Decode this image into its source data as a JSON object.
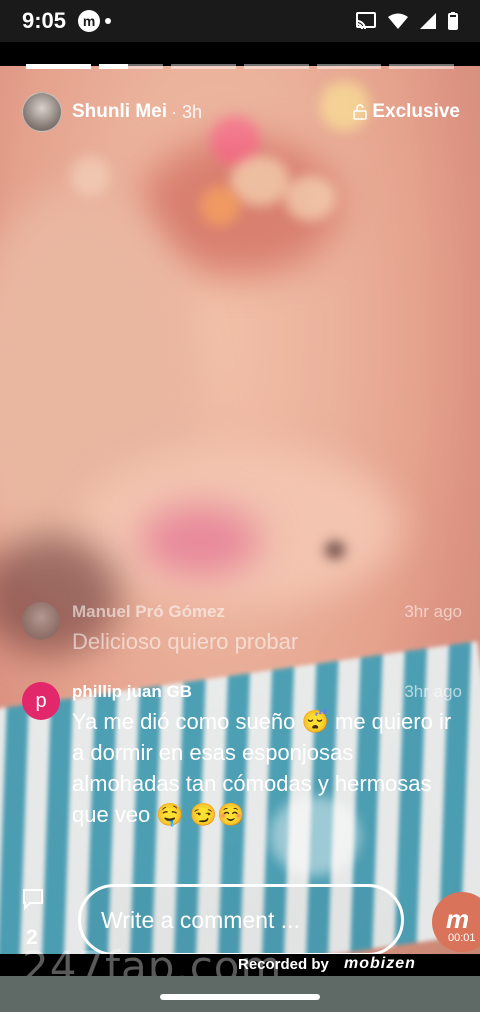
{
  "status_bar": {
    "time": "9:05",
    "app_icon_letter": "m"
  },
  "story": {
    "progress": [
      1,
      0.45,
      0,
      0,
      0,
      0
    ],
    "username": "Shunli Mei",
    "time_ago": "· 3h",
    "badge": "Exclusive"
  },
  "comments": [
    {
      "author": "Manuel Pró Gómez",
      "time": "3hr ago",
      "text": "Delicioso quiero probar",
      "avatar_letter": ""
    },
    {
      "author": "phillip juan GB",
      "time": "3hr ago",
      "text": "Ya me dió como sueño 😴 me quiero ir a dormir en esas esponjosas almohadas tan cómodas y hermosas que veo 🤤 😏☺️",
      "avatar_letter": "p"
    }
  ],
  "footer": {
    "comment_count": "2",
    "comment_placeholder": "Write a comment ...",
    "recording_time": "00:01",
    "recording_badge_letter": "m"
  },
  "overlay": {
    "watermark": "247fap.com",
    "recorded_by": "Recorded by",
    "recorder_brand": "mobizen"
  },
  "colors": {
    "accent_avatar": "#e2276b",
    "stripe": "#3d9fb8",
    "recorder": "#d9735a"
  }
}
